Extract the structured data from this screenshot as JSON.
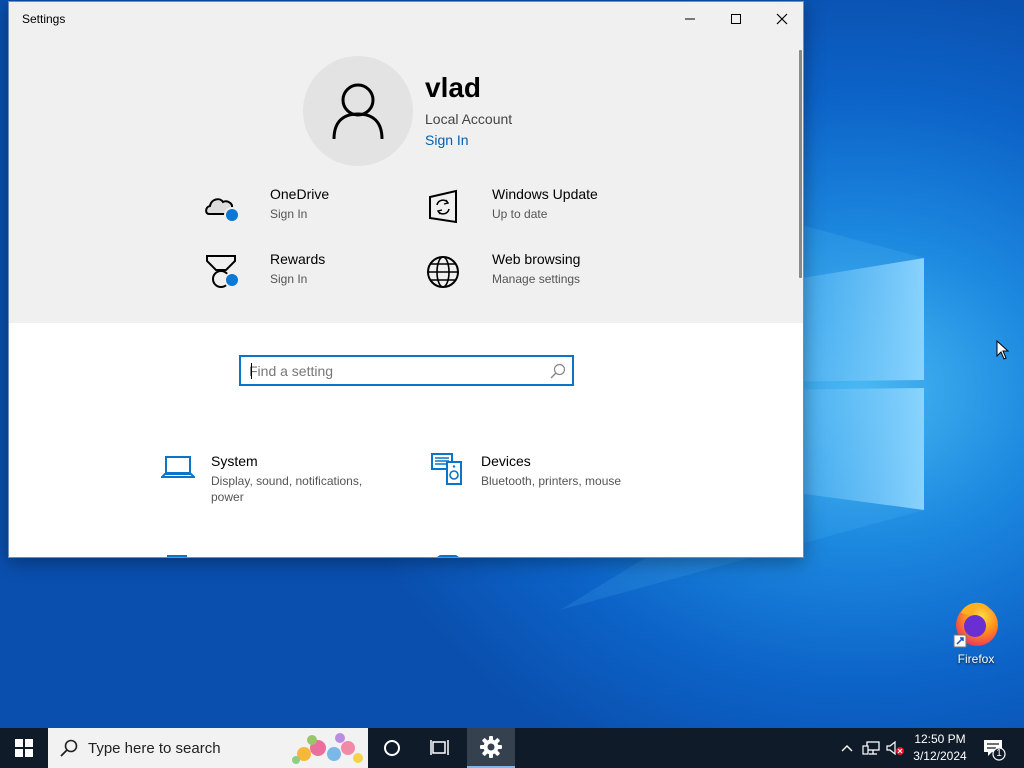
{
  "window": {
    "title": "Settings",
    "controls": {
      "minimize": "minimize-icon",
      "maximize": "maximize-icon",
      "close": "close-icon"
    }
  },
  "account": {
    "name": "vlad",
    "type": "Local Account",
    "sign_in": "Sign In"
  },
  "quick_links": [
    {
      "title": "OneDrive",
      "subtitle": "Sign In",
      "icon": "onedrive-icon"
    },
    {
      "title": "Windows Update",
      "subtitle": "Up to date",
      "icon": "windows-update-icon"
    },
    {
      "title": "Rewards",
      "subtitle": "Sign In",
      "icon": "rewards-icon"
    },
    {
      "title": "Web browsing",
      "subtitle": "Manage settings",
      "icon": "globe-icon"
    }
  ],
  "search": {
    "placeholder": "Find a setting",
    "value": ""
  },
  "categories": [
    {
      "title": "System",
      "subtitle": "Display, sound, notifications, power",
      "icon": "laptop-icon"
    },
    {
      "title": "Devices",
      "subtitle": "Bluetooth, printers, mouse",
      "icon": "devices-icon"
    }
  ],
  "desktop": {
    "icons": [
      {
        "label": "Firefox",
        "icon": "firefox-icon"
      }
    ]
  },
  "taskbar": {
    "search_placeholder": "Type here to search",
    "clock": {
      "time": "12:50 PM",
      "date": "3/12/2024"
    },
    "notifications_count": "1"
  },
  "colors": {
    "accent": "#0a78d4",
    "link": "#0060b3",
    "taskbar": "#101b2a"
  }
}
